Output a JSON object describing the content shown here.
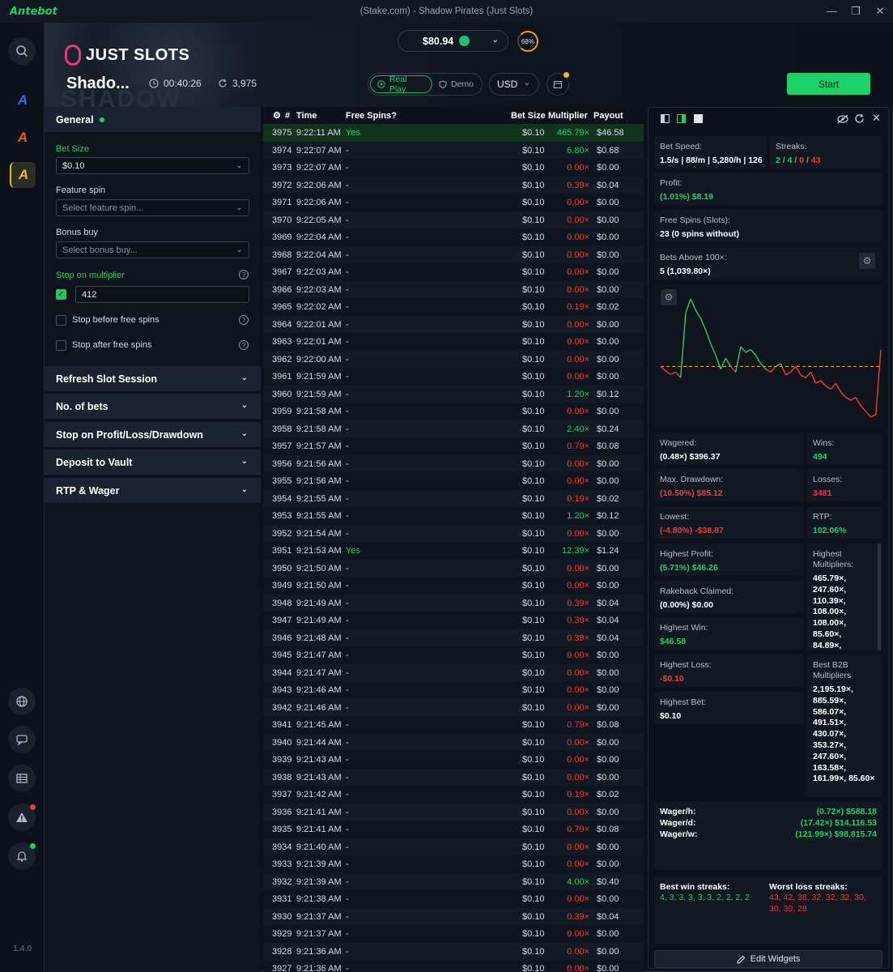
{
  "app": {
    "brand": "Antebot",
    "window_title": "(Stake.com) - Shadow Pirates (Just Slots)",
    "version": "1.4.0"
  },
  "header": {
    "provider_logo": "JUST SLOTS",
    "game_name": "Shado...",
    "elapsed": "00:40:26",
    "spin_count": "3,975",
    "balance": "$80.94",
    "progress_pct": "68%",
    "mode_real": "Real Play",
    "mode_demo": "Demo",
    "currency": "USD",
    "start_label": "Start",
    "colors": {
      "accent": "#1fd06a",
      "red": "#ef3b3b"
    }
  },
  "settings": {
    "general": {
      "title": "General"
    },
    "bet_size": {
      "label": "Bet Size",
      "value": "$0.10"
    },
    "feature_spin": {
      "label": "Feature spin",
      "placeholder": "Select feature spin..."
    },
    "bonus_buy": {
      "label": "Bonus buy",
      "placeholder": "Select bonus buy..."
    },
    "stop_multiplier": {
      "label": "Stop on multiplier",
      "checked": true,
      "value": "412"
    },
    "stop_before_free": {
      "label": "Stop before free spins",
      "checked": false
    },
    "stop_after_free": {
      "label": "Stop after free spins",
      "checked": false
    },
    "sections": [
      "Refresh Slot Session",
      "No. of bets",
      "Stop on Profit/Loss/Drawdown",
      "Deposit to Vault",
      "RTP & Wager"
    ]
  },
  "table": {
    "headers": {
      "num": "#",
      "time": "Time",
      "free_spins": "Free Spins?",
      "bet_size": "Bet Size",
      "multiplier": "Multiplier",
      "payout": "Payout"
    },
    "rows": [
      [
        "3975",
        "9:22:11 AM",
        "Yes",
        "$0.10",
        "465.79×",
        "$46.58"
      ],
      [
        "3974",
        "9:22:07 AM",
        "-",
        "$0.10",
        "6.80×",
        "$0.68"
      ],
      [
        "3973",
        "9:22:07 AM",
        "-",
        "$0.10",
        "0.00×",
        "$0.00"
      ],
      [
        "3972",
        "9:22:06 AM",
        "-",
        "$0.10",
        "0.39×",
        "$0.04"
      ],
      [
        "3971",
        "9:22:06 AM",
        "-",
        "$0.10",
        "0.00×",
        "$0.00"
      ],
      [
        "3970",
        "9:22:05 AM",
        "-",
        "$0.10",
        "0.00×",
        "$0.00"
      ],
      [
        "3969",
        "9:22:04 AM",
        "-",
        "$0.10",
        "0.00×",
        "$0.00"
      ],
      [
        "3968",
        "9:22:04 AM",
        "-",
        "$0.10",
        "0.00×",
        "$0.00"
      ],
      [
        "3967",
        "9:22:03 AM",
        "-",
        "$0.10",
        "0.00×",
        "$0.00"
      ],
      [
        "3966",
        "9:22:03 AM",
        "-",
        "$0.10",
        "0.00×",
        "$0.00"
      ],
      [
        "3965",
        "9:22:02 AM",
        "-",
        "$0.10",
        "0.19×",
        "$0.02"
      ],
      [
        "3964",
        "9:22:01 AM",
        "-",
        "$0.10",
        "0.00×",
        "$0.00"
      ],
      [
        "3963",
        "9:22:01 AM",
        "-",
        "$0.10",
        "0.00×",
        "$0.00"
      ],
      [
        "3962",
        "9:22:00 AM",
        "-",
        "$0.10",
        "0.00×",
        "$0.00"
      ],
      [
        "3961",
        "9:21:59 AM",
        "-",
        "$0.10",
        "0.00×",
        "$0.00"
      ],
      [
        "3960",
        "9:21:59 AM",
        "-",
        "$0.10",
        "1.20×",
        "$0.12"
      ],
      [
        "3959",
        "9:21:58 AM",
        "-",
        "$0.10",
        "0.00×",
        "$0.00"
      ],
      [
        "3958",
        "9:21:58 AM",
        "-",
        "$0.10",
        "2.40×",
        "$0.24"
      ],
      [
        "3957",
        "9:21:57 AM",
        "-",
        "$0.10",
        "0.79×",
        "$0.08"
      ],
      [
        "3956",
        "9:21:56 AM",
        "-",
        "$0.10",
        "0.00×",
        "$0.00"
      ],
      [
        "3955",
        "9:21:56 AM",
        "-",
        "$0.10",
        "0.00×",
        "$0.00"
      ],
      [
        "3954",
        "9:21:55 AM",
        "-",
        "$0.10",
        "0.19×",
        "$0.02"
      ],
      [
        "3953",
        "9:21:55 AM",
        "-",
        "$0.10",
        "1.20×",
        "$0.12"
      ],
      [
        "3952",
        "9:21:54 AM",
        "-",
        "$0.10",
        "0.00×",
        "$0.00"
      ],
      [
        "3951",
        "9:21:53 AM",
        "Yes",
        "$0.10",
        "12.39×",
        "$1.24"
      ],
      [
        "3950",
        "9:21:50 AM",
        "-",
        "$0.10",
        "0.00×",
        "$0.00"
      ],
      [
        "3949",
        "9:21:50 AM",
        "-",
        "$0.10",
        "0.00×",
        "$0.00"
      ],
      [
        "3948",
        "9:21:49 AM",
        "-",
        "$0.10",
        "0.39×",
        "$0.04"
      ],
      [
        "3947",
        "9:21:49 AM",
        "-",
        "$0.10",
        "0.39×",
        "$0.04"
      ],
      [
        "3946",
        "9:21:48 AM",
        "-",
        "$0.10",
        "0.39×",
        "$0.04"
      ],
      [
        "3945",
        "9:21:47 AM",
        "-",
        "$0.10",
        "0.00×",
        "$0.00"
      ],
      [
        "3944",
        "9:21:47 AM",
        "-",
        "$0.10",
        "0.00×",
        "$0.00"
      ],
      [
        "3943",
        "9:21:46 AM",
        "-",
        "$0.10",
        "0.00×",
        "$0.00"
      ],
      [
        "3942",
        "9:21:46 AM",
        "-",
        "$0.10",
        "0.00×",
        "$0.00"
      ],
      [
        "3941",
        "9:21:45 AM",
        "-",
        "$0.10",
        "0.79×",
        "$0.08"
      ],
      [
        "3940",
        "9:21:44 AM",
        "-",
        "$0.10",
        "0.00×",
        "$0.00"
      ],
      [
        "3939",
        "9:21:43 AM",
        "-",
        "$0.10",
        "0.00×",
        "$0.00"
      ],
      [
        "3938",
        "9:21:43 AM",
        "-",
        "$0.10",
        "0.00×",
        "$0.00"
      ],
      [
        "3937",
        "9:21:42 AM",
        "-",
        "$0.10",
        "0.19×",
        "$0.02"
      ],
      [
        "3936",
        "9:21:41 AM",
        "-",
        "$0.10",
        "0.00×",
        "$0.00"
      ],
      [
        "3935",
        "9:21:41 AM",
        "-",
        "$0.10",
        "0.79×",
        "$0.08"
      ],
      [
        "3934",
        "9:21:40 AM",
        "-",
        "$0.10",
        "0.00×",
        "$0.00"
      ],
      [
        "3933",
        "9:21:39 AM",
        "-",
        "$0.10",
        "0.00×",
        "$0.00"
      ],
      [
        "3932",
        "9:21:39 AM",
        "-",
        "$0.10",
        "4.00×",
        "$0.40"
      ],
      [
        "3931",
        "9:21:38 AM",
        "-",
        "$0.10",
        "0.00×",
        "$0.00"
      ],
      [
        "3930",
        "9:21:37 AM",
        "-",
        "$0.10",
        "0.39×",
        "$0.04"
      ],
      [
        "3929",
        "9:21:37 AM",
        "-",
        "$0.10",
        "0.00×",
        "$0.00"
      ],
      [
        "3928",
        "9:21:36 AM",
        "-",
        "$0.10",
        "0.00×",
        "$0.00"
      ],
      [
        "3927",
        "9:21:36 AM",
        "-",
        "$0.10",
        "0.00×",
        "$0.00"
      ]
    ]
  },
  "widgets": {
    "bet_speed": {
      "label": "Bet Speed:",
      "value": "1.5/s | 88/m | 5,280/h | 126"
    },
    "streaks": {
      "label": "Streaks:",
      "v1": "2",
      "v2": "4",
      "v3": "0",
      "v4": "43",
      "sep": " / "
    },
    "profit": {
      "label": "Profit:",
      "value": "(1.01%) $8.19"
    },
    "free_spins": {
      "label": "Free Spins (Slots):",
      "value": "23 (0 spins without)"
    },
    "bets_above": {
      "label": "Bets Above 100×:",
      "value": "5 (1,039.80×)"
    },
    "wagered": {
      "label": "Wagered:",
      "value": "(0.48×) $396.37"
    },
    "wins": {
      "label": "Wins:",
      "value": "494"
    },
    "max_drawdown": {
      "label": "Max. Drawdown:",
      "value": "(10.50%) $85.12"
    },
    "losses": {
      "label": "Losses:",
      "value": "3481"
    },
    "lowest": {
      "label": "Lowest:",
      "value": "(-4.80%) -$38.87"
    },
    "rtp": {
      "label": "RTP:",
      "value": "102.06%"
    },
    "highest_profit": {
      "label": "Highest Profit:",
      "value": "(5.71%) $46.26"
    },
    "highest_multipliers": {
      "label1": "Highest",
      "label2": "Multipliers:",
      "items": [
        "465.79×,",
        "247.60×,",
        "110.39×,",
        "108.00×,",
        "108.00×,",
        "85.60×,",
        "84.89×,"
      ]
    },
    "rakeback": {
      "label": "Rakeback Claimed:",
      "value": "(0.00%) $0.00"
    },
    "highest_win": {
      "label": "Highest Win:",
      "value": "$46.58"
    },
    "highest_loss": {
      "label": "Highest Loss:",
      "value": "-$0.10"
    },
    "best_b2b": {
      "label1": "Best B2B",
      "label2": "Multipliers",
      "items": [
        "2,195.19×,",
        "885.59×,",
        "586.07×,",
        "491.51×,",
        "430.07×,",
        "353.27×,",
        "247.60×,",
        "163.58×,",
        "161.99×, 85.60×"
      ]
    },
    "highest_bet": {
      "label": "Highest Bet:",
      "value": "$0.10"
    },
    "wager_h": {
      "label": "Wager/h:",
      "value": "(0.72×) $588.18"
    },
    "wager_d": {
      "label": "Wager/d:",
      "value": "(17.42×) $14,116.53"
    },
    "wager_w": {
      "label": "Wager/w:",
      "value": "(121.99×) $98,815.74"
    },
    "best_win_streaks": {
      "label": "Best win streaks:",
      "value": "4, 3, 3, 3, 3, 3, 2, 2, 2, 2"
    },
    "worst_loss_streaks": {
      "label": "Worst loss streaks:",
      "line1": "43, 42, 38, 32, 32, 32, 30,",
      "line2": "30, 30, 28"
    },
    "edit_label": "Edit Widgets"
  },
  "chart_data": {
    "type": "line",
    "series": [
      {
        "values": [
          0.0,
          -0.8,
          -1.4,
          -1.0,
          -2.0,
          9.5,
          12.0,
          10.0,
          8.5,
          6.5,
          4.0,
          2.0,
          -0.5,
          1.5,
          0.0,
          -1.0,
          3.5,
          2.5,
          3.0,
          2.0,
          0.5,
          -0.5,
          -1.0,
          0.0,
          0.5,
          -1.5,
          -1.0,
          0.0,
          -1.5,
          -2.0,
          -1.0,
          -3.0,
          -2.5,
          -3.5,
          -4.0,
          -3.0,
          -4.5,
          -5.5,
          -6.0,
          -5.5,
          -7.0,
          -8.0,
          -9.0,
          -8.5,
          3.0
        ]
      }
    ],
    "reference_line": 0
  }
}
